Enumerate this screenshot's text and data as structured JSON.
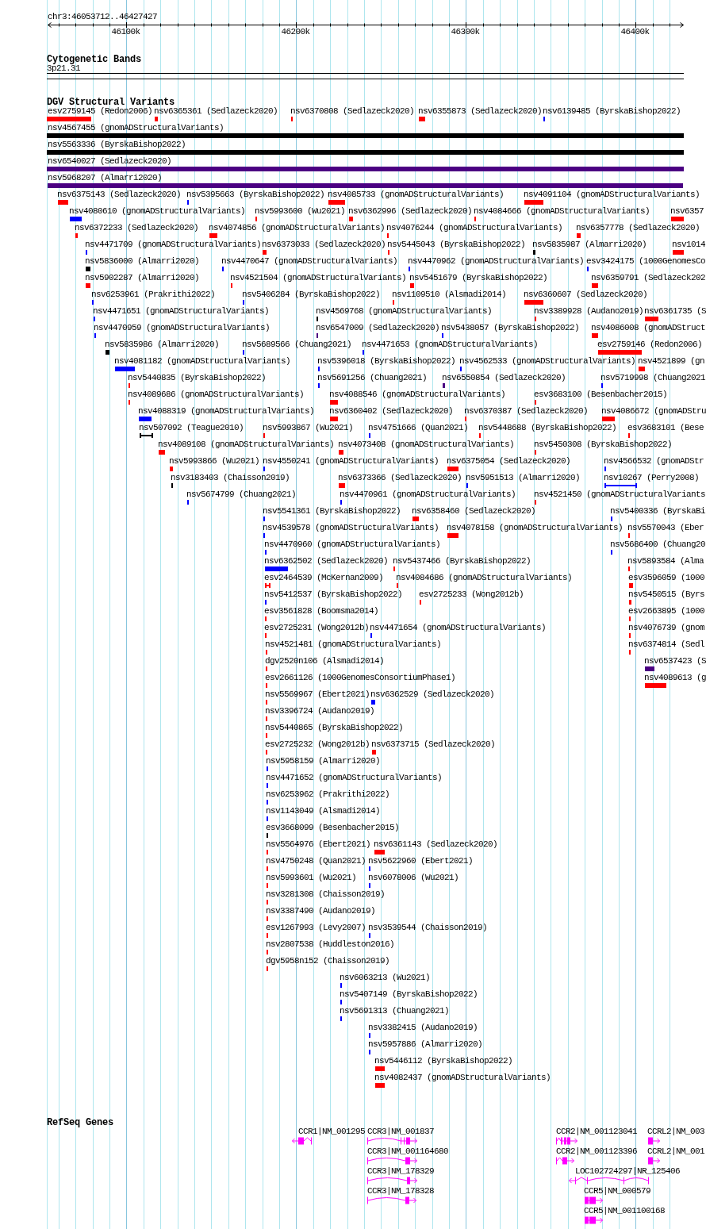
{
  "ruler": {
    "locus": "chr3:46053712..46427427",
    "ticks": [
      "46100k",
      "46200k",
      "46300k",
      "46400k"
    ]
  },
  "tracks": [
    {
      "kind": "bands",
      "title": "Cytogenetic Bands",
      "bands": [
        {
          "label": "3p21.31"
        }
      ]
    },
    {
      "kind": "variants",
      "title": "DGV Structural Variants",
      "features": [
        {
          "label": "esv2759145 (Redon2006)",
          "color": "#ff0000",
          "kind": "bar"
        },
        {
          "label": "nsv6365361 (Sedlazeck2020)",
          "color": "#ff0000",
          "kind": "bar"
        },
        {
          "label": "nsv6370808 (Sedlazeck2020)",
          "color": "#ff0000",
          "kind": "bar"
        },
        {
          "label": "nsv6355873 (Sedlazeck2020)",
          "color": "#ff0000",
          "kind": "bar"
        },
        {
          "label": "nsv6139485 (ByrskaBishop2022)",
          "color": "#0000ff",
          "kind": "bar"
        },
        {
          "label": "nsv4567455 (gnomADStructuralVariants)",
          "color": "#000000",
          "kind": "bar"
        },
        {
          "label": "nsv5563336 (ByrskaBishop2022)",
          "color": "#000000",
          "kind": "bar"
        },
        {
          "label": "nsv6540027 (Sedlazeck2020)",
          "color": "#4b0082",
          "kind": "bar"
        },
        {
          "label": "nsv5968207 (Almarri2020)",
          "color": "#4b0082",
          "kind": "bar"
        },
        {
          "label": "nsv6375143 (Sedlazeck2020)",
          "color": "#ff0000",
          "kind": "bar"
        },
        {
          "label": "nsv5395663 (ByrskaBishop2022)",
          "color": "#0000ff",
          "kind": "bar"
        },
        {
          "label": "nsv4085733 (gnomADStructuralVariants)",
          "color": "#ff0000",
          "kind": "bar"
        },
        {
          "label": "nsv4091104 (gnomADStructuralVariants)",
          "color": "#ff0000",
          "kind": "bar"
        },
        {
          "label": "nsv4080610 (gnomADStructuralVariants)",
          "color": "#0000ff",
          "kind": "bar"
        },
        {
          "label": "nsv5993600 (Wu2021)",
          "color": "#ff0000",
          "kind": "bar"
        },
        {
          "label": "nsv6362996 (Sedlazeck2020)",
          "color": "#ff0000",
          "kind": "bar"
        },
        {
          "label": "nsv4084666 (gnomADStructuralVariants)",
          "color": "#ff0000",
          "kind": "bar"
        },
        {
          "label": "nsv6357",
          "color": "#ff0000",
          "kind": "bar"
        },
        {
          "label": "nsv6372233 (Sedlazeck2020)",
          "color": "#ff0000",
          "kind": "bar"
        },
        {
          "label": "nsv4074856 (gnomADStructuralVariants)",
          "color": "#ff0000",
          "kind": "bar"
        },
        {
          "label": "nsv4076244 (gnomADStructuralVariants)",
          "color": "#ff0000",
          "kind": "bar"
        },
        {
          "label": "nsv6357778 (Sedlazeck2020)",
          "color": "#ff0000",
          "kind": "bar"
        },
        {
          "label": "nsv4471709 (gnomADStructuralVariants)",
          "color": "#0000ff",
          "kind": "bar"
        },
        {
          "label": "nsv6373033 (Sedlazeck2020)",
          "color": "#ff0000",
          "kind": "bar"
        },
        {
          "label": "nsv5445043 (ByrskaBishop2022)",
          "color": "#ff0000",
          "kind": "bar"
        },
        {
          "label": "nsv5835987 (Almarri2020)",
          "color": "#000000",
          "kind": "bar"
        },
        {
          "label": "nsv1014",
          "color": "#ff0000",
          "kind": "bar"
        },
        {
          "label": "nsv5836000 (Almarri2020)",
          "color": "#000000",
          "kind": "bar"
        },
        {
          "label": "nsv4470647 (gnomADStructuralVariants)",
          "color": "#0000ff",
          "kind": "bar"
        },
        {
          "label": "nsv4470962 (gnomADStructuralVariants)",
          "color": "#0000ff",
          "kind": "bar"
        },
        {
          "label": "esv3424175 (1000GenomesCo",
          "color": "#0000ff",
          "kind": "bar"
        },
        {
          "label": "nsv5902287 (Almarri2020)",
          "color": "#ff0000",
          "kind": "bar"
        },
        {
          "label": "nsv4521504 (gnomADStructuralVariants)",
          "color": "#ff0000",
          "kind": "bar"
        },
        {
          "label": "nsv5451679 (ByrskaBishop2022)",
          "color": "#ff0000",
          "kind": "bar"
        },
        {
          "label": "nsv6359791 (Sedlazeck202",
          "color": "#ff0000",
          "kind": "bar"
        },
        {
          "label": "nsv6253961 (Prakrithi2022)",
          "color": "#0000ff",
          "kind": "bar"
        },
        {
          "label": "nsv5406284 (ByrskaBishop2022)",
          "color": "#0000ff",
          "kind": "bar"
        },
        {
          "label": "nsv1109510 (Alsmadi2014)",
          "color": "#ff0000",
          "kind": "bar"
        },
        {
          "label": "nsv6360607 (Sedlazeck2020)",
          "color": "#ff0000",
          "kind": "bar"
        },
        {
          "label": "nsv4471651 (gnomADStructuralVariants)",
          "color": "#0000ff",
          "kind": "bar"
        },
        {
          "label": "nsv4569768 (gnomADStructuralVariants)",
          "color": "#000000",
          "kind": "bar"
        },
        {
          "label": "nsv3389928 (Audano2019)",
          "color": "#ff0000",
          "kind": "bar"
        },
        {
          "label": "nsv6361735 (S",
          "color": "#ff0000",
          "kind": "bar"
        },
        {
          "label": "nsv4470959 (gnomADStructuralVariants)",
          "color": "#0000ff",
          "kind": "bar"
        },
        {
          "label": "nsv6547009 (Sedlazeck2020)",
          "color": "#4b0082",
          "kind": "bar"
        },
        {
          "label": "nsv5438057 (ByrskaBishop2022)",
          "color": "#0000ff",
          "kind": "bar"
        },
        {
          "label": "nsv4086008 (gnomADStruct",
          "color": "#ff0000",
          "kind": "bar"
        },
        {
          "label": "nsv5835986 (Almarri2020)",
          "color": "#000000",
          "kind": "bar"
        },
        {
          "label": "nsv5689566 (Chuang2021)",
          "color": "#0000ff",
          "kind": "bar"
        },
        {
          "label": "nsv4471653 (gnomADStructuralVariants)",
          "color": "#0000ff",
          "kind": "bar"
        },
        {
          "label": "esv2759146 (Redon2006)",
          "color": "#ff0000",
          "kind": "bar"
        },
        {
          "label": "nsv4081182 (gnomADStructuralVariants)",
          "color": "#0000ff",
          "kind": "bar"
        },
        {
          "label": "nsv5396018 (ByrskaBishop2022)",
          "color": "#0000ff",
          "kind": "bar"
        },
        {
          "label": "nsv4562533 (gnomADStructuralVariants)",
          "color": "#0000ff",
          "kind": "bar"
        },
        {
          "label": "nsv4521899 (gn",
          "color": "#ff0000",
          "kind": "bar"
        },
        {
          "label": "nsv5440835 (ByrskaBishop2022)",
          "color": "#ff0000",
          "kind": "bar"
        },
        {
          "label": "nsv5691256 (Chuang2021)",
          "color": "#0000ff",
          "kind": "bar"
        },
        {
          "label": "nsv6550854 (Sedlazeck2020)",
          "color": "#4b0082",
          "kind": "bar"
        },
        {
          "label": "nsv5719998 (Chuang2021",
          "color": "#0000ff",
          "kind": "bar"
        },
        {
          "label": "nsv4089686 (gnomADStructuralVariants)",
          "color": "#ff0000",
          "kind": "bar"
        },
        {
          "label": "nsv4088546 (gnomADStructuralVariants)",
          "color": "#ff0000",
          "kind": "bar"
        },
        {
          "label": "esv3683100 (Besenbacher2015)",
          "color": "#ff0000",
          "kind": "bar"
        },
        {
          "label": "nsv4088319 (gnomADStructuralVariants)",
          "color": "#0000ff",
          "kind": "bar"
        },
        {
          "label": "nsv6360402 (Sedlazeck2020)",
          "color": "#ff0000",
          "kind": "bar"
        },
        {
          "label": "nsv6370387 (Sedlazeck2020)",
          "color": "#ff0000",
          "kind": "bar"
        },
        {
          "label": "nsv4086672 (gnomADStru",
          "color": "#ff0000",
          "kind": "bar"
        },
        {
          "label": "nsv507092 (Teague2010)",
          "color": "#000000",
          "kind": "span"
        },
        {
          "label": "nsv5993867 (Wu2021)",
          "color": "#ff0000",
          "kind": "bar"
        },
        {
          "label": "nsv4751666 (Quan2021)",
          "color": "#0000ff",
          "kind": "bar"
        },
        {
          "label": "nsv5448688 (ByrskaBishop2022)",
          "color": "#ff0000",
          "kind": "bar"
        },
        {
          "label": "esv3683101 (Bese",
          "color": "#ff0000",
          "kind": "bar"
        },
        {
          "label": "nsv4089108 (gnomADStructuralVariants)",
          "color": "#ff0000",
          "kind": "bar"
        },
        {
          "label": "nsv4073408 (gnomADStructuralVariants)",
          "color": "#ff0000",
          "kind": "bar"
        },
        {
          "label": "nsv5450308 (ByrskaBishop2022)",
          "color": "#ff0000",
          "kind": "bar"
        },
        {
          "label": "nsv5993866 (Wu2021)",
          "color": "#ff0000",
          "kind": "bar"
        },
        {
          "label": "nsv4550241 (gnomADStructuralVariants)",
          "color": "#0000ff",
          "kind": "bar"
        },
        {
          "label": "nsv6375054 (Sedlazeck2020)",
          "color": "#ff0000",
          "kind": "bar"
        },
        {
          "label": "nsv4566532 (gnomADStr",
          "color": "#0000ff",
          "kind": "bar"
        },
        {
          "label": "nsv3183403 (Chaisson2019)",
          "color": "#000000",
          "kind": "bar"
        },
        {
          "label": "nsv6373366 (Sedlazeck2020)",
          "color": "#ff0000",
          "kind": "bar"
        },
        {
          "label": "nsv5951513 (Almarri2020)",
          "color": "#0000ff",
          "kind": "bar"
        },
        {
          "label": "nsv10267 (Perry2008)",
          "color": "#0000ff",
          "kind": "span"
        },
        {
          "label": "nsv5674799 (Chuang2021)",
          "color": "#0000ff",
          "kind": "bar"
        },
        {
          "label": "nsv4470961 (gnomADStructuralVariants)",
          "color": "#0000ff",
          "kind": "bar"
        },
        {
          "label": "nsv4521450 (gnomADStructuralVariants",
          "color": "#ff0000",
          "kind": "bar"
        },
        {
          "label": "nsv5541361 (ByrskaBishop2022)",
          "color": "#0000ff",
          "kind": "bar"
        },
        {
          "label": "nsv6358460 (Sedlazeck2020)",
          "color": "#ff0000",
          "kind": "bar"
        },
        {
          "label": "nsv5400336 (ByrskaBi",
          "color": "#0000ff",
          "kind": "bar"
        },
        {
          "label": "nsv4539578 (gnomADStructuralVariants)",
          "color": "#0000ff",
          "kind": "bar"
        },
        {
          "label": "nsv4078158 (gnomADStructuralVariants)",
          "color": "#ff0000",
          "kind": "bar"
        },
        {
          "label": "nsv5570043 (Eber",
          "color": "#ff0000",
          "kind": "bar"
        },
        {
          "label": "nsv4470960 (gnomADStructuralVariants)",
          "color": "#0000ff",
          "kind": "bar"
        },
        {
          "label": "nsv5686400 (Chuang20",
          "color": "#0000ff",
          "kind": "bar"
        },
        {
          "label": "nsv6362502 (Sedlazeck2020)",
          "color": "#0000ff",
          "kind": "bar"
        },
        {
          "label": "nsv5437466 (ByrskaBishop2022)",
          "color": "#ff0000",
          "kind": "bar"
        },
        {
          "label": "nsv5893584 (Alma",
          "color": "#ff0000",
          "kind": "bar"
        },
        {
          "label": "esv2464539 (McKernan2009)",
          "color": "#ff0000",
          "kind": "span"
        },
        {
          "label": "nsv4084686 (gnomADStructuralVariants)",
          "color": "#ff0000",
          "kind": "bar"
        },
        {
          "label": "esv3596059 (1000",
          "color": "#ff0000",
          "kind": "bar"
        },
        {
          "label": "nsv5412537 (ByrskaBishop2022)",
          "color": "#0000ff",
          "kind": "bar"
        },
        {
          "label": "esv2725233 (Wong2012b)",
          "color": "#ff0000",
          "kind": "bar"
        },
        {
          "label": "nsv5450515 (Byrs",
          "color": "#ff0000",
          "kind": "bar"
        },
        {
          "label": "esv3561828 (Boomsma2014)",
          "color": "#ff0000",
          "kind": "bar"
        },
        {
          "label": "esv2663895 (1000",
          "color": "#ff0000",
          "kind": "bar"
        },
        {
          "label": "esv2725231 (Wong2012b)",
          "color": "#ff0000",
          "kind": "bar"
        },
        {
          "label": "nsv4471654 (gnomADStructuralVariants)",
          "color": "#0000ff",
          "kind": "bar"
        },
        {
          "label": "nsv4076739 (gnom",
          "color": "#ff0000",
          "kind": "bar"
        },
        {
          "label": "nsv4521481 (gnomADStructuralVariants)",
          "color": "#ff0000",
          "kind": "bar"
        },
        {
          "label": "nsv6374814 (Sedl",
          "color": "#ff0000",
          "kind": "bar"
        },
        {
          "label": "dgv2520n106 (Alsmadi2014)",
          "color": "#ff0000",
          "kind": "bar"
        },
        {
          "label": "nsv6537423 (S",
          "color": "#4b0082",
          "kind": "bar"
        },
        {
          "label": "esv2661126 (1000GenomesConsortiumPhase1)",
          "color": "#ff0000",
          "kind": "bar"
        },
        {
          "label": "nsv4089613 (g",
          "color": "#ff0000",
          "kind": "bar"
        },
        {
          "label": "nsv5569967 (Ebert2021)",
          "color": "#ff0000",
          "kind": "bar"
        },
        {
          "label": "nsv6362529 (Sedlazeck2020)",
          "color": "#0000ff",
          "kind": "bar"
        },
        {
          "label": "nsv3396724 (Audano2019)",
          "color": "#ff0000",
          "kind": "bar"
        },
        {
          "label": "nsv5440865 (ByrskaBishop2022)",
          "color": "#ff0000",
          "kind": "bar"
        },
        {
          "label": "esv2725232 (Wong2012b)",
          "color": "#ff0000",
          "kind": "bar"
        },
        {
          "label": "nsv6373715 (Sedlazeck2020)",
          "color": "#ff0000",
          "kind": "bar"
        },
        {
          "label": "nsv5958159 (Almarri2020)",
          "color": "#0000ff",
          "kind": "bar"
        },
        {
          "label": "nsv4471652 (gnomADStructuralVariants)",
          "color": "#0000ff",
          "kind": "bar"
        },
        {
          "label": "nsv6253962 (Prakrithi2022)",
          "color": "#0000ff",
          "kind": "bar"
        },
        {
          "label": "nsv1143049 (Alsmadi2014)",
          "color": "#0000ff",
          "kind": "bar"
        },
        {
          "label": "esv3668099 (Besenbacher2015)",
          "color": "#000000",
          "kind": "bar"
        },
        {
          "label": "nsv5564976 (Ebert2021)",
          "color": "#ff0000",
          "kind": "bar"
        },
        {
          "label": "nsv6361143 (Sedlazeck2020)",
          "color": "#ff0000",
          "kind": "bar"
        },
        {
          "label": "nsv4750248 (Quan2021)",
          "color": "#ff0000",
          "kind": "bar"
        },
        {
          "label": "nsv5622960 (Ebert2021)",
          "color": "#0000ff",
          "kind": "bar"
        },
        {
          "label": "nsv5993601 (Wu2021)",
          "color": "#ff0000",
          "kind": "bar"
        },
        {
          "label": "nsv6078006 (Wu2021)",
          "color": "#0000ff",
          "kind": "bar"
        },
        {
          "label": "nsv3281308 (Chaisson2019)",
          "color": "#ff0000",
          "kind": "bar"
        },
        {
          "label": "nsv3387490 (Audano2019)",
          "color": "#ff0000",
          "kind": "bar"
        },
        {
          "label": "esv1267993 (Levy2007)",
          "color": "#ff0000",
          "kind": "bar"
        },
        {
          "label": "nsv3539544 (Chaisson2019)",
          "color": "#0000ff",
          "kind": "bar"
        },
        {
          "label": "nsv2807538 (Huddleston2016)",
          "color": "#ff0000",
          "kind": "bar"
        },
        {
          "label": "dgv5958n152 (Chaisson2019)",
          "color": "#ff0000",
          "kind": "bar"
        },
        {
          "label": "nsv6063213 (Wu2021)",
          "color": "#0000ff",
          "kind": "bar"
        },
        {
          "label": "nsv5407149 (ByrskaBishop2022)",
          "color": "#0000ff",
          "kind": "bar"
        },
        {
          "label": "nsv5691313 (Chuang2021)",
          "color": "#0000ff",
          "kind": "bar"
        },
        {
          "label": "nsv3382415 (Audano2019)",
          "color": "#0000ff",
          "kind": "bar"
        },
        {
          "label": "nsv5957886 (Almarri2020)",
          "color": "#0000ff",
          "kind": "bar"
        },
        {
          "label": "nsv5446112 (ByrskaBishop2022)",
          "color": "#ff0000",
          "kind": "bar"
        },
        {
          "label": "nsv4082437 (gnomADStructuralVariants)",
          "color": "#ff0000",
          "kind": "bar"
        }
      ]
    },
    {
      "kind": "genes",
      "title": "RefSeq Genes",
      "features": [
        {
          "label": "CCR1|NM_001295",
          "kind": "reverse"
        },
        {
          "label": "CCR3|NM_001837",
          "kind": "forward"
        },
        {
          "label": "CCR2|NM_001123041",
          "kind": "forward"
        },
        {
          "label": "CCRL2|NM_003",
          "kind": "forward"
        },
        {
          "label": "CCR3|NM_001164680",
          "kind": "forward"
        },
        {
          "label": "CCR2|NM_001123396",
          "kind": "forward"
        },
        {
          "label": "CCRL2|NM_001",
          "kind": "forward"
        },
        {
          "label": "CCR3|NM_178329",
          "kind": "forward"
        },
        {
          "label": "LOC102724297|NR_125406",
          "kind": "reverse"
        },
        {
          "label": "CCR3|NM_178328",
          "kind": "forward"
        },
        {
          "label": "CCR5|NM_000579",
          "kind": "forward"
        },
        {
          "label": "CCR5|NM_001100168",
          "kind": "forward"
        }
      ]
    }
  ]
}
